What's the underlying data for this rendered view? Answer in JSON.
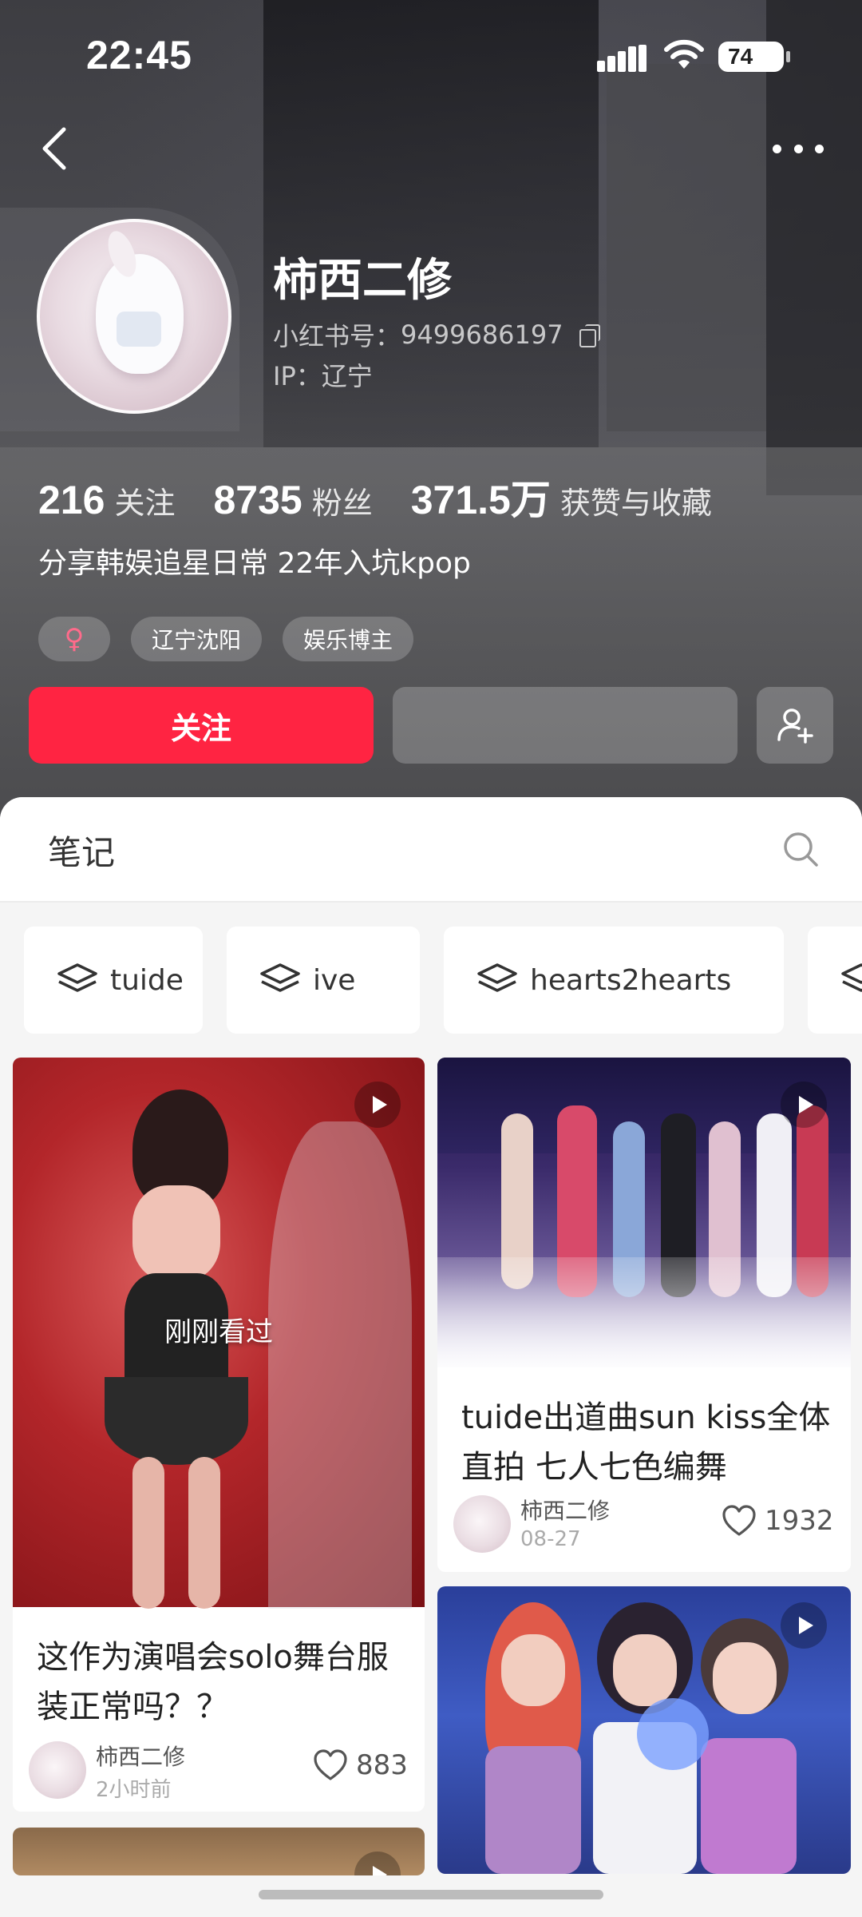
{
  "status_bar": {
    "time": "22:45",
    "battery": "74"
  },
  "profile": {
    "name": "柿西二修",
    "red_id_label": "小红书号：",
    "red_id": "9499686197",
    "ip": "IP：辽宁",
    "stats": [
      {
        "value": "216",
        "label": "关注"
      },
      {
        "value": "8735",
        "label": "粉丝"
      },
      {
        "value": "371.5万",
        "label": "获赞与收藏"
      }
    ],
    "bio": "分享韩娱追星日常 22年入坑kpop",
    "tags": [
      "♀",
      "辽宁沈阳",
      "娱乐博主"
    ],
    "follow_label": "关注"
  },
  "tabs": {
    "notes_label": "笔记"
  },
  "collections": [
    "tuide",
    "ive",
    "hearts2hearts"
  ],
  "notes": [
    {
      "title": "这作为演唱会solo舞台服装正常吗？？",
      "author": "柿西二修",
      "date": "2小时前",
      "likes": "883",
      "overlay": "刚刚看过"
    },
    {
      "title": "tuide出道曲sun kiss全体直拍 七人七色编舞",
      "author": "柿西二修",
      "date": "08-27",
      "likes": "1932"
    }
  ],
  "colors": {
    "accent": "#ff2442",
    "header_bg": "#4a4a4f"
  }
}
